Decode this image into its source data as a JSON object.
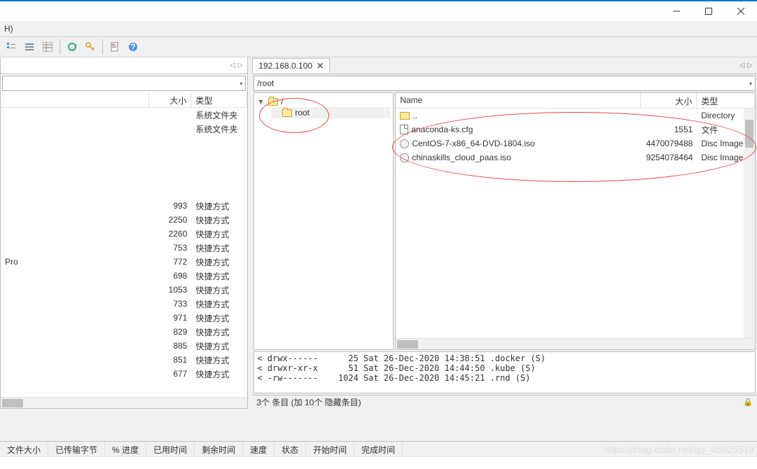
{
  "window": {
    "menu_h": "H)"
  },
  "remote": {
    "tab_label": "192.168.0.100",
    "path": "/root",
    "tree": {
      "root": "/",
      "child": "root"
    },
    "columns": {
      "name": "Name",
      "size": "大小",
      "type": "类型"
    },
    "files": [
      {
        "name": "..",
        "size": "",
        "type": "Directory",
        "icon": "up"
      },
      {
        "name": "anaconda-ks.cfg",
        "size": "1551",
        "type": "文件",
        "icon": "cfg"
      },
      {
        "name": "CentOS-7-x86_64-DVD-1804.iso",
        "size": "4470079488",
        "type": "Disc Image F",
        "icon": "disc"
      },
      {
        "name": "chinaskills_cloud_paas.iso",
        "size": "9254078464",
        "type": "Disc Image F",
        "icon": "disc"
      }
    ],
    "terminal_lines": "< drwx------      25 Sat 26-Dec-2020 14:38:51 .docker (S)\n< drwxr-xr-x      51 Sat 26-Dec-2020 14:44:50 .kube (S)\n< -rw-------    1024 Sat 26-Dec-2020 14:45:21 .rnd (S)",
    "status": "3个 条目 (加 10个 隐藏条目)"
  },
  "local": {
    "columns": {
      "name": "",
      "size": "大小",
      "type": "类型"
    },
    "top_rows": [
      {
        "name": "",
        "size": "",
        "type": "系统文件夹"
      },
      {
        "name": "",
        "size": "",
        "type": "系统文件夹"
      }
    ],
    "rows": [
      {
        "name": "",
        "size": "993",
        "type": "快捷方式"
      },
      {
        "name": "",
        "size": "2250",
        "type": "快捷方式"
      },
      {
        "name": "",
        "size": "2260",
        "type": "快捷方式"
      },
      {
        "name": "",
        "size": "753",
        "type": "快捷方式"
      },
      {
        "name": "Pro",
        "size": "772",
        "type": "快捷方式"
      },
      {
        "name": "",
        "size": "698",
        "type": "快捷方式"
      },
      {
        "name": "",
        "size": "1053",
        "type": "快捷方式"
      },
      {
        "name": "",
        "size": "733",
        "type": "快捷方式"
      },
      {
        "name": "",
        "size": "971",
        "type": "快捷方式"
      },
      {
        "name": "",
        "size": "829",
        "type": "快捷方式"
      },
      {
        "name": "",
        "size": "885",
        "type": "快捷方式"
      },
      {
        "name": "",
        "size": "851",
        "type": "快捷方式"
      },
      {
        "name": "",
        "size": "677",
        "type": "快捷方式"
      }
    ]
  },
  "bottom": {
    "cols": [
      "文件大小",
      "已传输字节",
      "% 进度",
      "已用时间",
      "剩余时间",
      "速度",
      "状态",
      "开始时间",
      "完成时间"
    ]
  },
  "watermark": "https://blog.csdn.net/qq_45925514"
}
